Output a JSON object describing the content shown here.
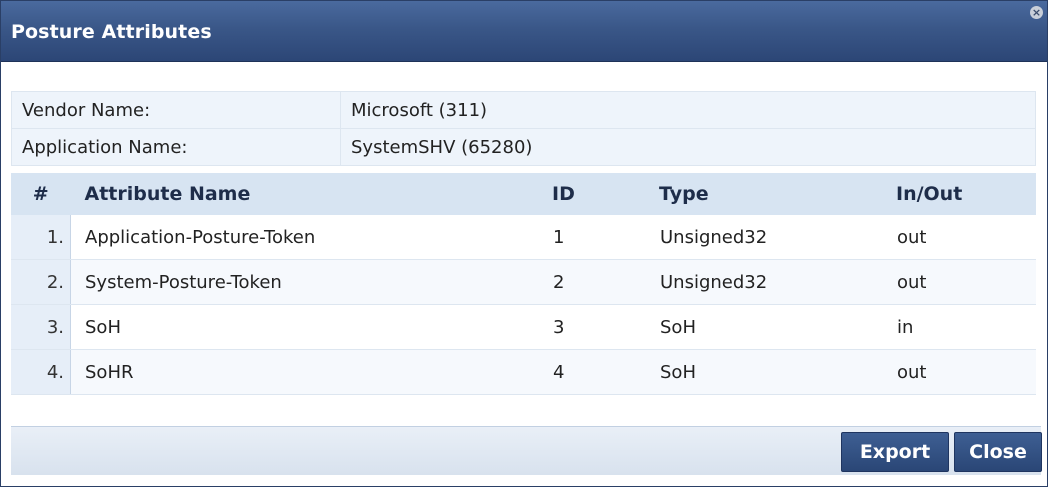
{
  "dialog": {
    "title": "Posture Attributes",
    "close_glyph": "×"
  },
  "info": {
    "vendor_label": "Vendor Name:",
    "vendor_value": "Microsoft (311)",
    "application_label": "Application Name:",
    "application_value": "SystemSHV (65280)"
  },
  "table": {
    "headers": [
      "#",
      "Attribute Name",
      "ID",
      "Type",
      "In/Out"
    ],
    "rows": [
      {
        "num": "1.",
        "name": "Application-Posture-Token",
        "id": "1",
        "type": "Unsigned32",
        "inout": "out"
      },
      {
        "num": "2.",
        "name": "System-Posture-Token",
        "id": "2",
        "type": "Unsigned32",
        "inout": "out"
      },
      {
        "num": "3.",
        "name": "SoH",
        "id": "3",
        "type": "SoH",
        "inout": "in"
      },
      {
        "num": "4.",
        "name": "SoHR",
        "id": "4",
        "type": "SoH",
        "inout": "out"
      }
    ]
  },
  "footer": {
    "export_label": "Export",
    "close_label": "Close"
  },
  "colors": {
    "titlebar": "#3a5788",
    "header_row": "#d7e4f2",
    "button": "#2a4676"
  }
}
